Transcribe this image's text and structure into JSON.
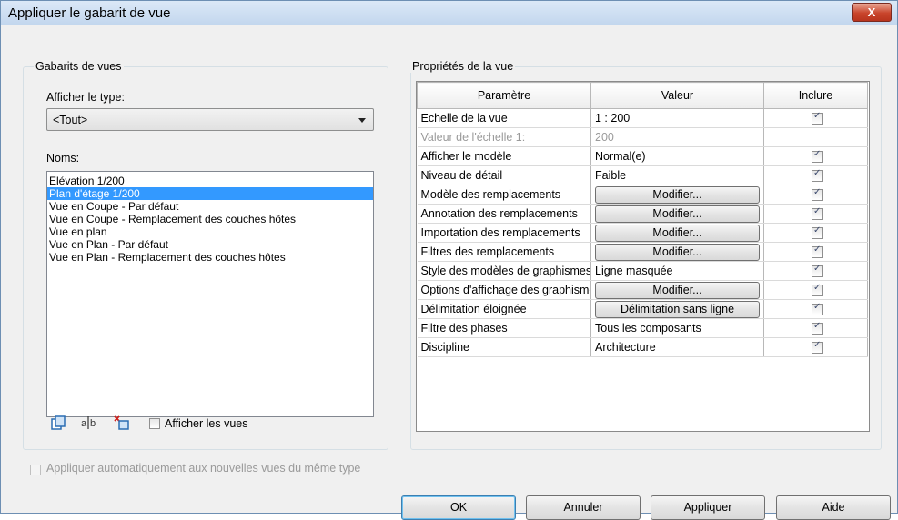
{
  "window": {
    "title": "Appliquer le gabarit de vue",
    "close_label": "X"
  },
  "left_group": {
    "title": "Gabarits de vues",
    "type_label": "Afficher le type:",
    "type_value": "<Tout>",
    "names_label": "Noms:",
    "names": [
      "Elévation 1/200",
      "Plan d'étage 1/200",
      "Vue en Coupe - Par défaut",
      "Vue en Coupe - Remplacement des couches hôtes",
      "Vue en plan",
      "Vue en Plan - Par défaut",
      "Vue en Plan - Remplacement des couches hôtes"
    ],
    "selected_index": 1,
    "show_views_label": "Afficher les vues",
    "icons": [
      "duplicate-icon",
      "rename-icon",
      "delete-icon"
    ]
  },
  "auto_apply_label": "Appliquer automatiquement aux nouvelles vues du même type",
  "properties": {
    "title": "Propriétés de la vue",
    "headers": [
      "Paramètre",
      "Valeur",
      "Inclure"
    ],
    "rows": [
      {
        "param": "Echelle de la vue",
        "value": "1 : 200",
        "type": "text",
        "include": true
      },
      {
        "param": "Valeur de l'échelle    1:",
        "value": "200",
        "type": "text",
        "include": null,
        "disabled": true
      },
      {
        "param": "Afficher le modèle",
        "value": "Normal(e)",
        "type": "text",
        "include": true
      },
      {
        "param": "Niveau de détail",
        "value": "Faible",
        "type": "text",
        "include": true
      },
      {
        "param": "Modèle des remplacements",
        "value": "Modifier...",
        "type": "button",
        "include": true
      },
      {
        "param": "Annotation des remplacements",
        "value": "Modifier...",
        "type": "button",
        "include": true
      },
      {
        "param": "Importation des remplacements",
        "value": "Modifier...",
        "type": "button",
        "include": true
      },
      {
        "param": "Filtres des remplacements",
        "value": "Modifier...",
        "type": "button",
        "include": true
      },
      {
        "param": "Style des modèles de graphismes",
        "value": "Ligne masquée",
        "type": "text",
        "include": true
      },
      {
        "param": "Options d'affichage des graphismes",
        "value": "Modifier...",
        "type": "button",
        "include": true
      },
      {
        "param": "Délimitation éloignée",
        "value": "Délimitation sans ligne",
        "type": "button",
        "include": true
      },
      {
        "param": "Filtre des phases",
        "value": "Tous les composants",
        "type": "text",
        "include": true
      },
      {
        "param": "Discipline",
        "value": "Architecture",
        "type": "text",
        "include": true
      }
    ]
  },
  "buttons": {
    "ok": "OK",
    "cancel": "Annuler",
    "apply": "Appliquer",
    "help": "Aide"
  }
}
